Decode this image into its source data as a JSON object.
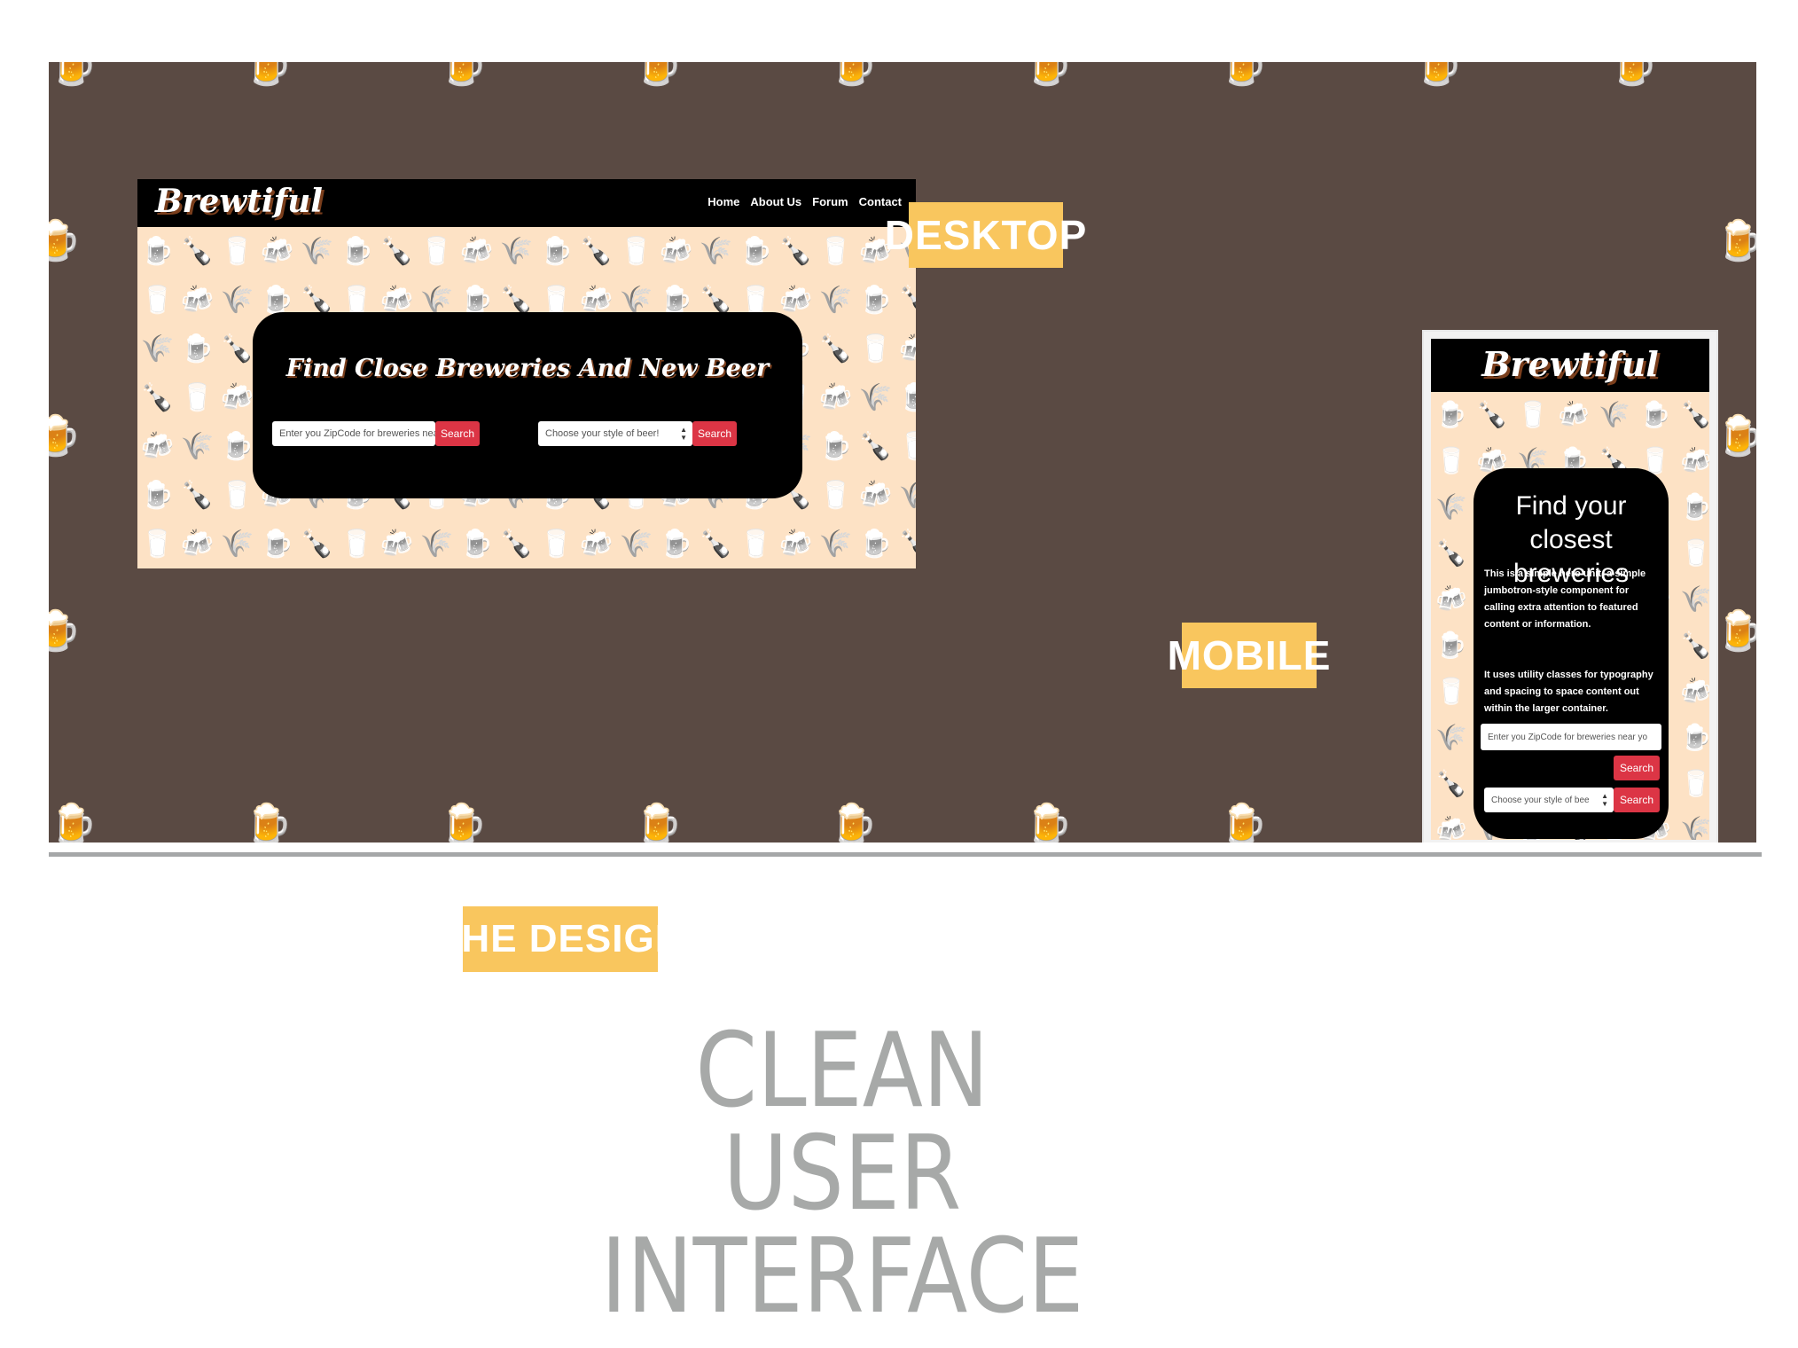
{
  "labels": {
    "desktop": "DESKTOP",
    "mobile": "MOBILE",
    "the_design": "THE DESIGN"
  },
  "headline": {
    "line1": "CLEAN USER",
    "line2": "INTERFACE"
  },
  "desktop_site": {
    "brand": "Brewtiful",
    "nav": [
      "Home",
      "About Us",
      "Forum",
      "Contact"
    ],
    "hero_title": "Find Close Breweries And New Beer",
    "zip_placeholder": "Enter you ZipCode for breweries near",
    "zip_button": "Search",
    "style_select": "Choose your style of beer!",
    "style_button": "Search"
  },
  "mobile_site": {
    "brand": "Brewtiful",
    "hero_title": "Find your closest breweries",
    "paragraph1": "This is a simple hero unit, a simple jumbotron-style component for calling extra attention to featured content or information.",
    "paragraph2": "It uses utility classes for typography and spacing to space content out within the larger container.",
    "zip_placeholder": "Enter you ZipCode for breweries near yo",
    "zip_button": "Search",
    "style_select": "Choose your style of bee",
    "style_button": "Search"
  },
  "icons": {
    "beer_mug": "beer-mug-icon",
    "bottle": "bottle-icon",
    "glass": "glass-icon",
    "barrel": "barrel-icon",
    "wheat": "wheat-icon"
  },
  "colors": {
    "panel": "#5a4a43",
    "label": "#f9c65e",
    "pattern_bg": "#fde2c5",
    "button": "#dc3545",
    "headline": "#a7a9a8"
  }
}
